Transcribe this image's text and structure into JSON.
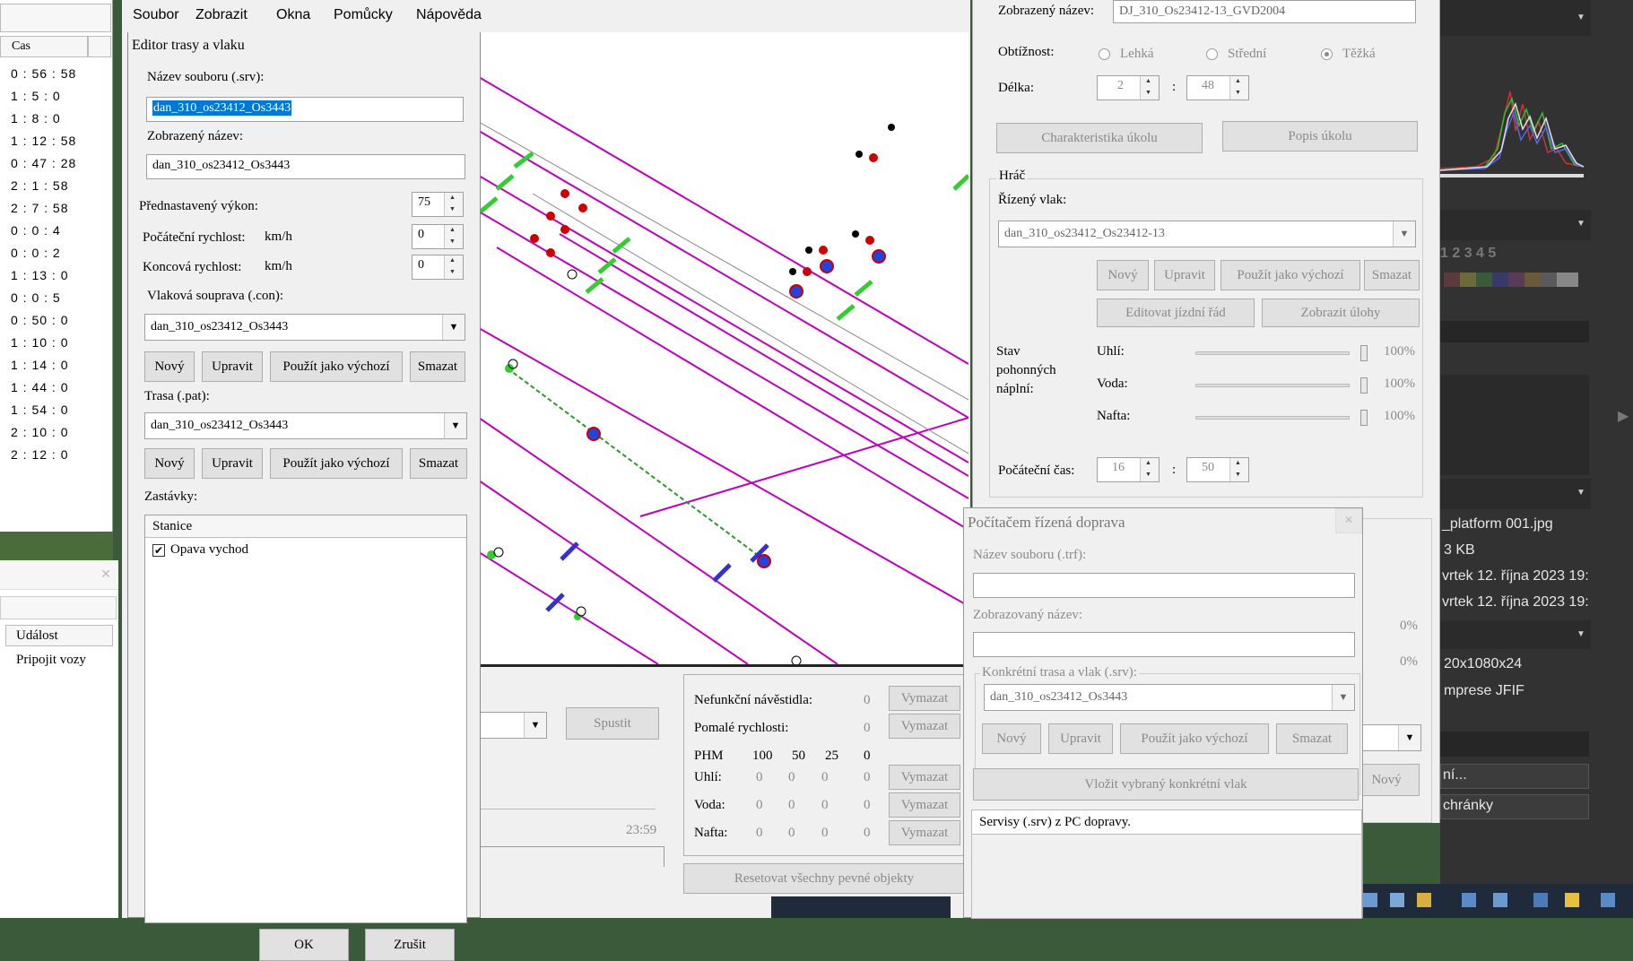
{
  "menu": [
    "Soubor",
    "Zobrazit",
    "Okna",
    "Pomůcky",
    "Nápověda"
  ],
  "left_panel": {
    "col_header": "Cas",
    "times": [
      "0 : 56 : 58",
      "1 : 5 : 0",
      "1 : 8 : 0",
      "1 : 12 : 58",
      "0 : 47 : 28",
      "2 : 1 : 58",
      "2 : 7 : 58",
      "0 : 0 : 4",
      "0 : 0 : 2",
      "1 : 13 : 0",
      "0 : 0 : 5",
      "0 : 50 : 0",
      "1 : 10 : 0",
      "1 : 14 : 0",
      "1 : 44 : 0",
      "1 : 54 : 0",
      "2 : 10 : 0",
      "2 : 12 : 0"
    ],
    "event_header": "Událost",
    "event_item": "Pripojit vozy"
  },
  "editor": {
    "title": "Editor trasy a vlaku",
    "file_label": "Název souboru (.srv):",
    "file_value": "dan_310_os23412_Os3443",
    "display_label": "Zobrazený název:",
    "display_value": "dan_310_os23412_Os3443",
    "power_label": "Přednastavený výkon:",
    "power_value": "75",
    "start_speed_label": "Počáteční rychlost:",
    "unit": "km/h",
    "start_speed_value": "0",
    "end_speed_label": "Koncová rychlost:",
    "end_speed_value": "0",
    "consist_label": "Vlaková souprava (.con):",
    "consist_value": "dan_310_os23412_Os3443",
    "btn_new": "Nový",
    "btn_edit": "Upravit",
    "btn_default": "Použít jako výchozí",
    "btn_delete": "Smazat",
    "path_label": "Trasa (.pat):",
    "path_value": "dan_310_os23412_Os3443",
    "stops_label": "Zastávky:",
    "station_header": "Stanice",
    "station_1": "Opava vychod",
    "ok": "OK",
    "cancel": "Zrušit"
  },
  "activity": {
    "display_name_label": "Zobrazený název:",
    "display_name_value": "DJ_310_Os23412-13_GVD2004",
    "difficulty_label": "Obtížnost:",
    "easy": "Lehká",
    "medium": "Střední",
    "hard": "Těžká",
    "length_label": "Délka:",
    "length_h": "2",
    "length_m": "48",
    "colon": ":",
    "btn_char": "Charakteristika úkolu",
    "btn_desc": "Popis úkolu",
    "player_group": "Hráč",
    "train_label": "Řízený vlak:",
    "train_value": "dan_310_os23412_Os23412-13",
    "btn_new": "Nový",
    "btn_edit": "Upravit",
    "btn_default": "Použít jako výchozí",
    "btn_delete": "Smazat",
    "btn_timetable": "Editovat jízdní řád",
    "btn_tasks": "Zobrazit úlohy",
    "fuel_label_1": "Stav",
    "fuel_label_2": "pohonných",
    "fuel_label_3": "náplní:",
    "coal": "Uhlí:",
    "water": "Voda:",
    "diesel": "Nafta:",
    "pct": "100%",
    "start_time_label": "Počáteční čas:",
    "start_h": "16",
    "start_m": "50",
    "btn_new2": "Nový"
  },
  "traffic": {
    "title": "Počítačem řízená doprava",
    "file_label": "Název souboru (.trf):",
    "display_label": "Zobrazovaný název:",
    "group_label": "Konkrétní trasa a vlak (.srv):",
    "srv_value": "dan_310_os23412_Os3443",
    "btn_new": "Nový",
    "btn_edit": "Upravit",
    "btn_default": "Použít jako výchozí",
    "btn_delete": "Smazat",
    "btn_insert": "Vložit vybraný konkrétní vlak",
    "list_header": "Servisy (.srv) z PC dopravy."
  },
  "bottom": {
    "btn_run": "Spustit",
    "time": "23:59",
    "signals": "Nefunkční návěstidla:",
    "slow": "Pomalé rychlosti:",
    "phm": "PHM",
    "p100": "100",
    "p50": "50",
    "p25": "25",
    "p0": "0",
    "zero": "0",
    "coal": "Uhlí:",
    "water": "Voda:",
    "diesel": "Nafta:",
    "btn_clear": "Vymazat",
    "btn_reset": "Resetovat všechny pevné objekty"
  },
  "ps": {
    "file": "_platform 001.jpg",
    "size": "3 KB",
    "date1": "vrtek 12. října 2023 19:",
    "date2": "vrtek 12. října 2023 19:",
    "dims": "20x1080x24",
    "comp": "mprese JFIF",
    "pct0a": "0%",
    "pct0b": "0%",
    "nums": "1 2 3 4 5",
    "btn1": "ní...",
    "btn2": "chránky"
  }
}
